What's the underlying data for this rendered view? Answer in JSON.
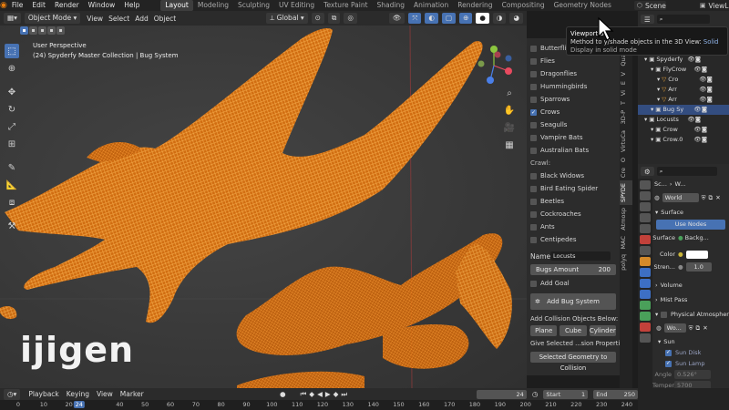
{
  "topbar": {
    "menus": [
      "File",
      "Edit",
      "Render",
      "Window",
      "Help"
    ],
    "workspaces": [
      "Layout",
      "Modeling",
      "Sculpting",
      "UV Editing",
      "Texture Paint",
      "Shading",
      "Animation",
      "Rendering",
      "Compositing",
      "Geometry Nodes"
    ],
    "active_workspace": "Layout",
    "scene_label": "Scene",
    "view_layer_label": "ViewLayer"
  },
  "viewport_header": {
    "mode": "Object Mode",
    "menus": [
      "View",
      "Select",
      "Add",
      "Object"
    ],
    "orientation": "Global"
  },
  "viewport": {
    "view_name": "User Perspective",
    "collection_info": "(24) Spyderfy Master Collection | Bug System"
  },
  "tooltip": {
    "title": "Viewport S",
    "line1": "Method to",
    "line1_rest": "y/shade objects in the 3D View:",
    "line1_value": "Solid",
    "line2": "Display in solid mode"
  },
  "npanel": {
    "fly_items": [
      {
        "label": "Butterflie",
        "checked": false
      },
      {
        "label": "Flies",
        "checked": false
      },
      {
        "label": "Dragonflies",
        "checked": false
      },
      {
        "label": "Hummingbirds",
        "checked": false
      },
      {
        "label": "Sparrows",
        "checked": false
      },
      {
        "label": "Crows",
        "checked": true
      },
      {
        "label": "Seagulls",
        "checked": false
      },
      {
        "label": "Vampire Bats",
        "checked": false
      },
      {
        "label": "Australian Bats",
        "checked": false
      }
    ],
    "crawl_label": "Crawl:",
    "crawl_items": [
      {
        "label": "Black Widows",
        "checked": false
      },
      {
        "label": "Bird Eating Spider",
        "checked": false
      },
      {
        "label": "Beetles",
        "checked": false
      },
      {
        "label": "Cockroaches",
        "checked": false
      },
      {
        "label": "Ants",
        "checked": false
      },
      {
        "label": "Centipedes",
        "checked": false
      }
    ],
    "name_label": "Name",
    "name_value": "Locusts",
    "bugs_amount_label": "Bugs Amount",
    "bugs_amount_value": "200",
    "add_goal_label": "Add Goal",
    "add_bug_system": "Add Bug System",
    "collision_label": "Add Collision Objects Below:",
    "collision_buttons": [
      "Plane",
      "Cube",
      "Cylinder"
    ],
    "give_selected": "Give Selected ...sion Properties:",
    "selected_geometry": "Selected Geometry to Collision"
  },
  "vtabs": [
    "Quad Re",
    "V",
    "E",
    "Vi",
    "T",
    "3D-P",
    "VirtuCa",
    "O",
    "Cre",
    "SPYDE",
    "Atmosp",
    "MAC",
    "polyq"
  ],
  "outliner": {
    "rows": [
      {
        "label": "Spyderfy",
        "indent": 1,
        "selected": false
      },
      {
        "label": "FlyCrow",
        "indent": 2,
        "selected": false
      },
      {
        "label": "Cro",
        "indent": 3,
        "selected": false
      },
      {
        "label": "Arr",
        "indent": 3,
        "selected": false
      },
      {
        "label": "Arr",
        "indent": 3,
        "selected": false
      },
      {
        "label": "Bug Sy",
        "indent": 2,
        "selected": true
      },
      {
        "label": "Locusts",
        "indent": 1,
        "selected": false
      },
      {
        "label": "Crow",
        "indent": 2,
        "selected": false
      },
      {
        "label": "Crow.0",
        "indent": 2,
        "selected": false
      }
    ]
  },
  "properties": {
    "scene_crumb": "Sc...",
    "world_crumb": "W...",
    "world_name": "World",
    "surface_header": "Surface",
    "use_nodes": "Use Nodes",
    "surface_label": "Surface",
    "surface_value": "Backg...",
    "color_label": "Color",
    "strength_label": "Stren...",
    "strength_value": "1.0",
    "volume_header": "Volume",
    "mist_header": "Mist Pass",
    "atmos_header": "Physical Atmospher",
    "atmos_object": "Wo...",
    "sun_header": "Sun",
    "sun_disk": "Sun Disk",
    "sun_lamp": "Sun Lamp",
    "angle_label": "Angle",
    "angle_value": "0.526°",
    "temp_label": "Tempera",
    "temp_value": "5700"
  },
  "timeline": {
    "menus": [
      "Playback",
      "Keying",
      "View",
      "Marker"
    ],
    "current_frame": "24",
    "start_label": "Start",
    "start_value": "1",
    "end_label": "End",
    "end_value": "250",
    "ticks": [
      "0",
      "10",
      "20",
      "24",
      "40",
      "50",
      "60",
      "70",
      "80",
      "90",
      "100",
      "110",
      "120",
      "130",
      "140",
      "150",
      "160",
      "170",
      "180",
      "190",
      "200",
      "210",
      "220",
      "230",
      "240"
    ]
  },
  "watermark": "ijigen",
  "colors": {
    "accent": "#4772b3",
    "wire": "#ff8a1f",
    "current_frame": "#4772b3"
  }
}
